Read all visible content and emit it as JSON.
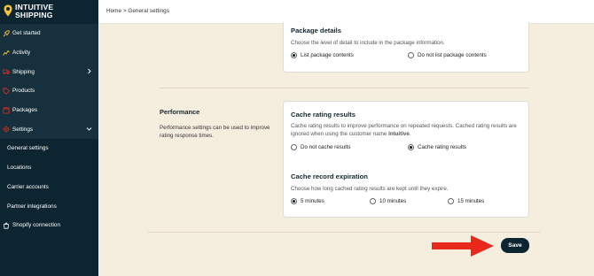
{
  "brand": {
    "line1": "INTUITIVE",
    "line2": "SHIPPING"
  },
  "sidebar": {
    "items": [
      {
        "label": "Get started",
        "icon": "rocket-icon"
      },
      {
        "label": "Activity",
        "icon": "activity-icon"
      },
      {
        "label": "Shipping",
        "icon": "truck-icon"
      },
      {
        "label": "Products",
        "icon": "tag-icon"
      },
      {
        "label": "Packages",
        "icon": "box-icon"
      },
      {
        "label": "Settings",
        "icon": "gear-icon"
      },
      {
        "label": "General settings"
      },
      {
        "label": "Locations"
      },
      {
        "label": "Carrier accounts"
      },
      {
        "label": "Partner integrations"
      },
      {
        "label": "Shopify connection",
        "icon": "shopify-icon"
      }
    ]
  },
  "breadcrumb": {
    "home": "Home",
    "separator": ">",
    "current": "General settings"
  },
  "package_details": {
    "title": "Package details",
    "description": "Choose the level of detail to include in the package information.",
    "options": [
      {
        "label": "List package contents",
        "checked": true
      },
      {
        "label": "Do not list package contents",
        "checked": false
      }
    ]
  },
  "performance": {
    "title": "Performance",
    "description": "Performance settings can be used to improve rating response times.",
    "cache_rating": {
      "title": "Cache rating results",
      "description_main": "Cache rating results to improve performance on repeated requests. Cached rating results are ignored when using the customer name",
      "description_bold": "Intuitive",
      "description_end": ".",
      "options": [
        {
          "label": "Do not cache results",
          "checked": false
        },
        {
          "label": "Cache rating results",
          "checked": true
        }
      ]
    },
    "cache_expiration": {
      "title": "Cache record expiration",
      "description": "Choose how long cached rating results are kept until they expire.",
      "options": [
        {
          "label": "5 minutes",
          "checked": true
        },
        {
          "label": "10 minutes",
          "checked": false
        },
        {
          "label": "15 minutes",
          "checked": false
        }
      ]
    }
  },
  "actions": {
    "save_label": "Save"
  },
  "colors": {
    "sidebar_bg": "#0d2530",
    "page_bg": "#f5eedf",
    "accent_yellow": "#f6c432",
    "arrow_red": "#e8291c"
  }
}
